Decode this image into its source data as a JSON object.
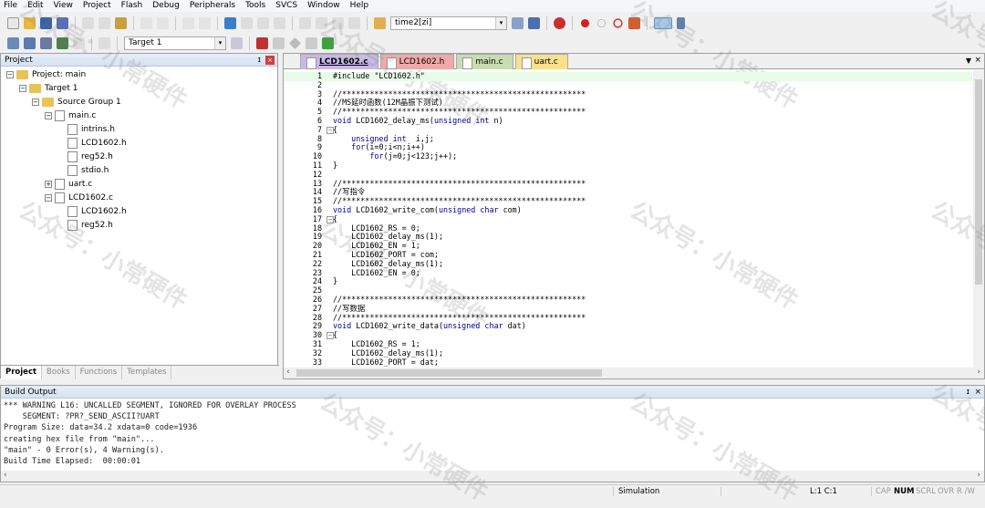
{
  "menu": [
    "File",
    "Edit",
    "View",
    "Project",
    "Flash",
    "Debug",
    "Peripherals",
    "Tools",
    "SVCS",
    "Window",
    "Help"
  ],
  "toolbar": {
    "find_combo": "time2[zi]",
    "target_combo": "Target 1"
  },
  "project_panel": {
    "title": "Project",
    "tree": [
      {
        "label": "Project: main",
        "level": 0,
        "type": "project",
        "exp": "-"
      },
      {
        "label": "Target 1",
        "level": 1,
        "type": "folder",
        "exp": "-"
      },
      {
        "label": "Source Group 1",
        "level": 2,
        "type": "folder",
        "exp": "-"
      },
      {
        "label": "main.c",
        "level": 3,
        "type": "file",
        "exp": "-"
      },
      {
        "label": "intrins.h",
        "level": 4,
        "type": "file",
        "exp": ""
      },
      {
        "label": "LCD1602.h",
        "level": 4,
        "type": "file",
        "exp": ""
      },
      {
        "label": "reg52.h",
        "level": 4,
        "type": "file",
        "exp": ""
      },
      {
        "label": "stdio.h",
        "level": 4,
        "type": "file",
        "exp": ""
      },
      {
        "label": "uart.c",
        "level": 3,
        "type": "file",
        "exp": "+"
      },
      {
        "label": "LCD1602.c",
        "level": 3,
        "type": "file",
        "exp": "-"
      },
      {
        "label": "LCD1602.h",
        "level": 4,
        "type": "file",
        "exp": ""
      },
      {
        "label": "reg52.h",
        "level": 4,
        "type": "file",
        "exp": ""
      }
    ],
    "tabs": [
      "Project",
      "Books",
      "Functions",
      "Templates"
    ]
  },
  "editor": {
    "tabs": [
      {
        "label": "LCD1602.c",
        "color": "#c9b8e8",
        "active": true
      },
      {
        "label": "LCD1602.h",
        "color": "#f0a8a8"
      },
      {
        "label": "main.c",
        "color": "#c8dcb0"
      },
      {
        "label": "uart.c",
        "color": "#f8e08c"
      }
    ],
    "lines": [
      "#include \"LCD1602.h\"",
      "",
      "//*****************************************************",
      "//MS延时函数(12M晶振下测试)",
      "//*****************************************************",
      "void LCD1602_delay_ms(unsigned int n)",
      "{",
      "    unsigned int  i,j;",
      "    for(i=0;i<n;i++)",
      "        for(j=0;j<123;j++);",
      "}",
      "",
      "//*****************************************************",
      "//写指令",
      "//*****************************************************",
      "void LCD1602_write_com(unsigned char com)",
      "{",
      "    LCD1602_RS = 0;",
      "    LCD1602_delay_ms(1);",
      "    LCD1602_EN = 1;",
      "    LCD1602_PORT = com;",
      "    LCD1602_delay_ms(1);",
      "    LCD1602_EN = 0;",
      "}",
      "",
      "//*****************************************************",
      "//写数据",
      "//*****************************************************",
      "void LCD1602_write_data(unsigned char dat)",
      "{",
      "    LCD1602_RS = 1;",
      "    LCD1602_delay_ms(1);",
      "    LCD1602_PORT = dat;"
    ]
  },
  "build_output": {
    "title": "Build Output",
    "lines": [
      "*** WARNING L16: UNCALLED SEGMENT, IGNORED FOR OVERLAY PROCESS",
      "    SEGMENT: ?PR?_SEND_ASCII?UART",
      "Program Size: data=34.2 xdata=0 code=1936",
      "creating hex file from \"main\"...",
      "\"main\" - 0 Error(s), 4 Warning(s).",
      "Build Time Elapsed:  00:00:01"
    ]
  },
  "status": {
    "mode": "Simulation",
    "position": "L:1 C:1",
    "cap": "CAP",
    "num": "NUM",
    "scrl": "SCRL",
    "ovr": "OVR",
    "rw": "R /W"
  },
  "watermark": "公众号：小常硬件"
}
